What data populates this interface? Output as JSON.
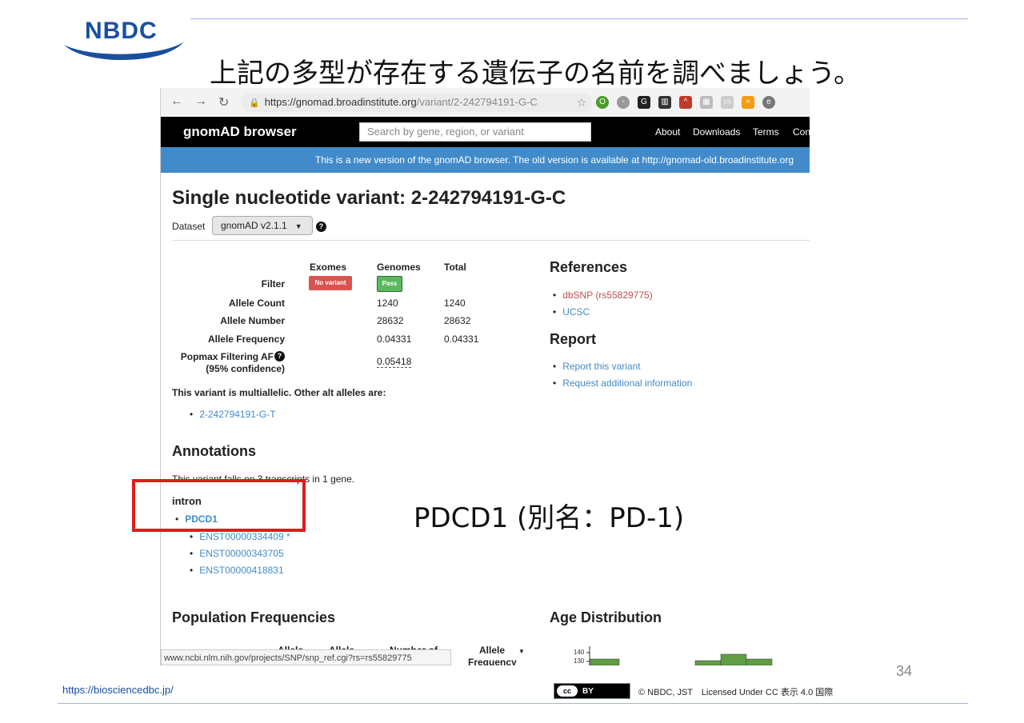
{
  "slide": {
    "logo": "NBDC",
    "title": "上記の多型が存在する遺伝子の名前を調べましょう。",
    "overlay_answer": "PDCD1 (別名：PD-1)",
    "footer_url": "https://biosciencedbc.jp/",
    "page_number": "34",
    "cc_label": "cc",
    "cc_by": "BY",
    "license": "© NBDC, JST　Licensed Under CC 表示 4.0 国際"
  },
  "browser": {
    "url_host": "https://gnomad.broadinstitute.org",
    "url_path": "/variant/2-242794191-G-C",
    "status_url": "www.ncbi.nlm.nih.gov/projects/SNP/snp_ref.cgi?rs=rs55829775"
  },
  "site": {
    "brand": "gnomAD browser",
    "search_placeholder": "Search by gene, region, or variant",
    "nav": [
      "About",
      "Downloads",
      "Terms",
      "Con"
    ],
    "notice": "This is a new version of the gnomAD browser. The old version is available at http://gnomad-old.broadinstitute.org"
  },
  "variant": {
    "heading": "Single nucleotide variant: 2-242794191-G-C",
    "dataset_label": "Dataset",
    "dataset_value": "gnomAD v2.1.1"
  },
  "freq_table": {
    "columns": [
      "Exomes",
      "Genomes",
      "Total"
    ],
    "rows": {
      "filter": {
        "label": "Filter",
        "exomes": "No variant",
        "genomes": "Pass"
      },
      "allele_count": {
        "label": "Allele Count",
        "genomes": "1240",
        "total": "1240"
      },
      "allele_number": {
        "label": "Allele Number",
        "genomes": "28632",
        "total": "28632"
      },
      "allele_frequency": {
        "label": "Allele Frequency",
        "genomes": "0.04331",
        "total": "0.04331"
      },
      "popmax": {
        "label": "Popmax Filtering AF",
        "label2": "(95% confidence)",
        "genomes": "0.05418"
      }
    },
    "multiallelic_note": "This variant is multiallelic. Other alt alleles are:",
    "other_alleles": [
      "2-242794191-G-T"
    ]
  },
  "references": {
    "title": "References",
    "items": [
      "dbSNP (rs55829775)",
      "UCSC"
    ]
  },
  "report": {
    "title": "Report",
    "items": [
      "Report this variant",
      "Request additional information"
    ]
  },
  "annotations": {
    "title": "Annotations",
    "summary": "This variant falls on 3 transcripts in 1 gene.",
    "consequence": "intron",
    "gene": "PDCD1",
    "transcripts": [
      "ENST00000334409 *",
      "ENST00000343705",
      "ENST00000418831"
    ]
  },
  "population": {
    "title": "Population Frequencies",
    "col_headers": [
      "Allele",
      "Allele",
      "Number of",
      "Allele",
      "Frequency"
    ]
  },
  "age": {
    "title": "Age Distribution",
    "ticks": [
      "140",
      "130"
    ]
  }
}
